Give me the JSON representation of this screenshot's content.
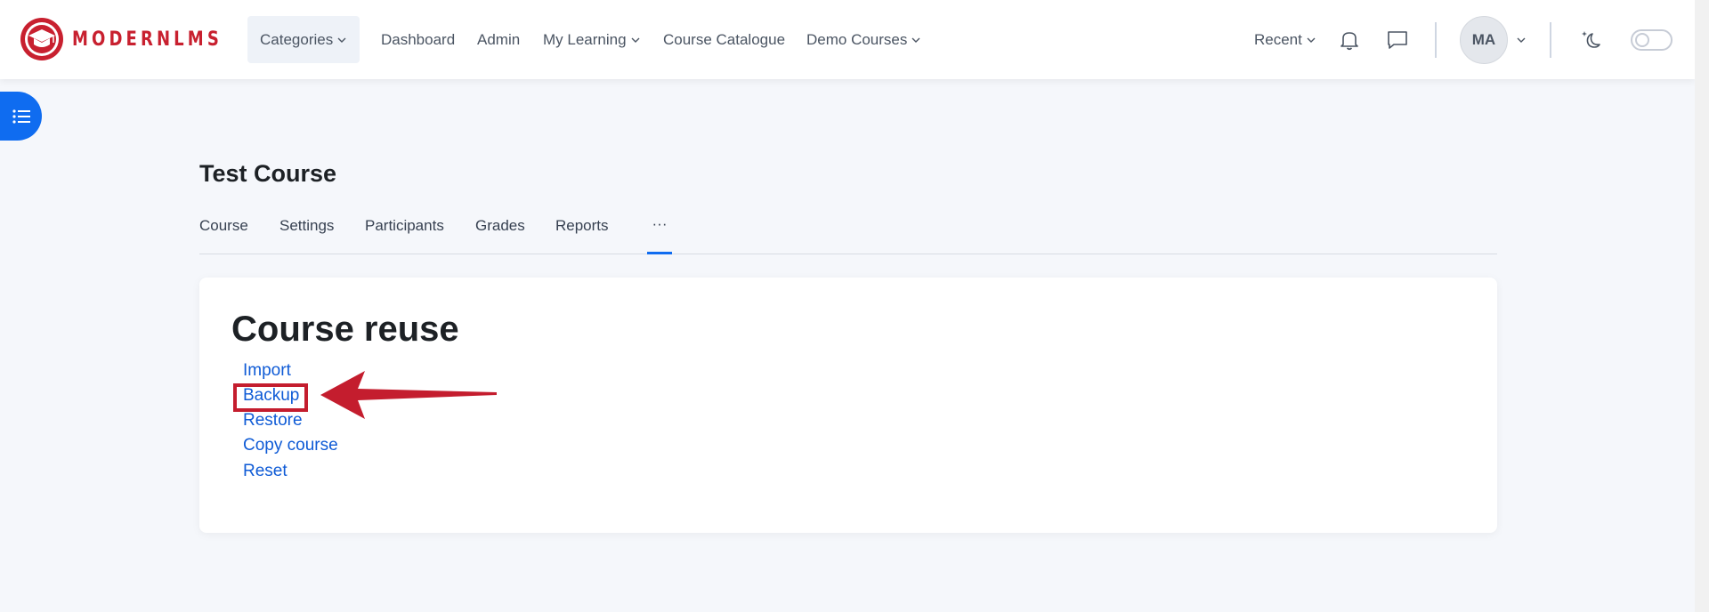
{
  "brand": {
    "name": "MODERNLMS",
    "color": "#c8202f"
  },
  "navbar": {
    "items": [
      {
        "label": "Categories",
        "has_dropdown": true
      },
      {
        "label": "Dashboard"
      },
      {
        "label": "Admin"
      },
      {
        "label": "My Learning",
        "has_dropdown": true
      },
      {
        "label": "Course Catalogue"
      },
      {
        "label": "Demo Courses",
        "has_dropdown": true
      }
    ],
    "recent": {
      "label": "Recent",
      "has_dropdown": true
    },
    "icons": [
      "bell-icon",
      "chat-icon",
      "moon-stars-icon"
    ],
    "user": {
      "initials": "MA"
    },
    "dark_mode_toggle": {
      "on": false
    }
  },
  "course": {
    "title": "Test Course",
    "tabs": [
      {
        "label": "Course"
      },
      {
        "label": "Settings"
      },
      {
        "label": "Participants"
      },
      {
        "label": "Grades"
      },
      {
        "label": "Reports"
      }
    ],
    "more_tab": {
      "label": "···",
      "active": true
    }
  },
  "card": {
    "heading": "Course reuse",
    "links": [
      {
        "label": "Import"
      },
      {
        "label": "Backup",
        "highlighted": true
      },
      {
        "label": "Restore"
      },
      {
        "label": "Copy course"
      },
      {
        "label": "Reset"
      }
    ]
  },
  "colors": {
    "accent": "#0f6cf0",
    "link": "#0f5bd6",
    "annotation": "#c41d2e"
  }
}
